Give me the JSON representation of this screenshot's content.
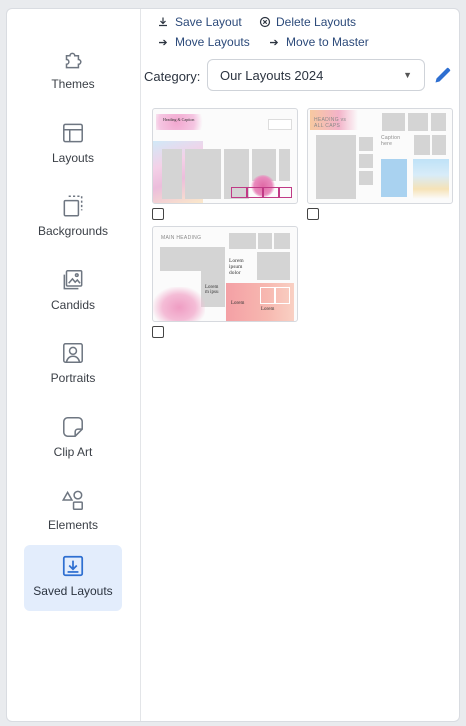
{
  "sidebar": {
    "items": [
      {
        "label": "Themes",
        "icon": "puzzle-icon"
      },
      {
        "label": "Layouts",
        "icon": "layout-icon"
      },
      {
        "label": "Backgrounds",
        "icon": "background-icon"
      },
      {
        "label": "Candids",
        "icon": "photos-icon"
      },
      {
        "label": "Portraits",
        "icon": "portrait-icon"
      },
      {
        "label": "Clip Art",
        "icon": "sticker-icon"
      },
      {
        "label": "Elements",
        "icon": "shapes-icon"
      },
      {
        "label": "Saved Layouts",
        "icon": "download-box-icon"
      }
    ],
    "active_index": 7
  },
  "actions": {
    "save_layout": "Save Layout",
    "delete_layouts": "Delete Layouts",
    "move_layouts": "Move Layouts",
    "move_to_master": "Move to Master"
  },
  "category": {
    "label": "Category:",
    "value": "Our Layouts 2024"
  },
  "layouts": [
    {
      "heading": "Heading & Caption",
      "checked": false
    },
    {
      "heading": "HEADING vs ALL CAPS",
      "caption": "Caption here",
      "checked": false
    },
    {
      "heading": "MAIN HEADING",
      "text1": "Lorem ipsum dolor",
      "text2": "Lorem m ipsu",
      "text3": "Lorem",
      "text4": "Lorem",
      "checked": false
    }
  ],
  "colors": {
    "accent": "#2e6fd1",
    "active_bg": "#e3edfc",
    "link_text": "#2c4a7a"
  }
}
